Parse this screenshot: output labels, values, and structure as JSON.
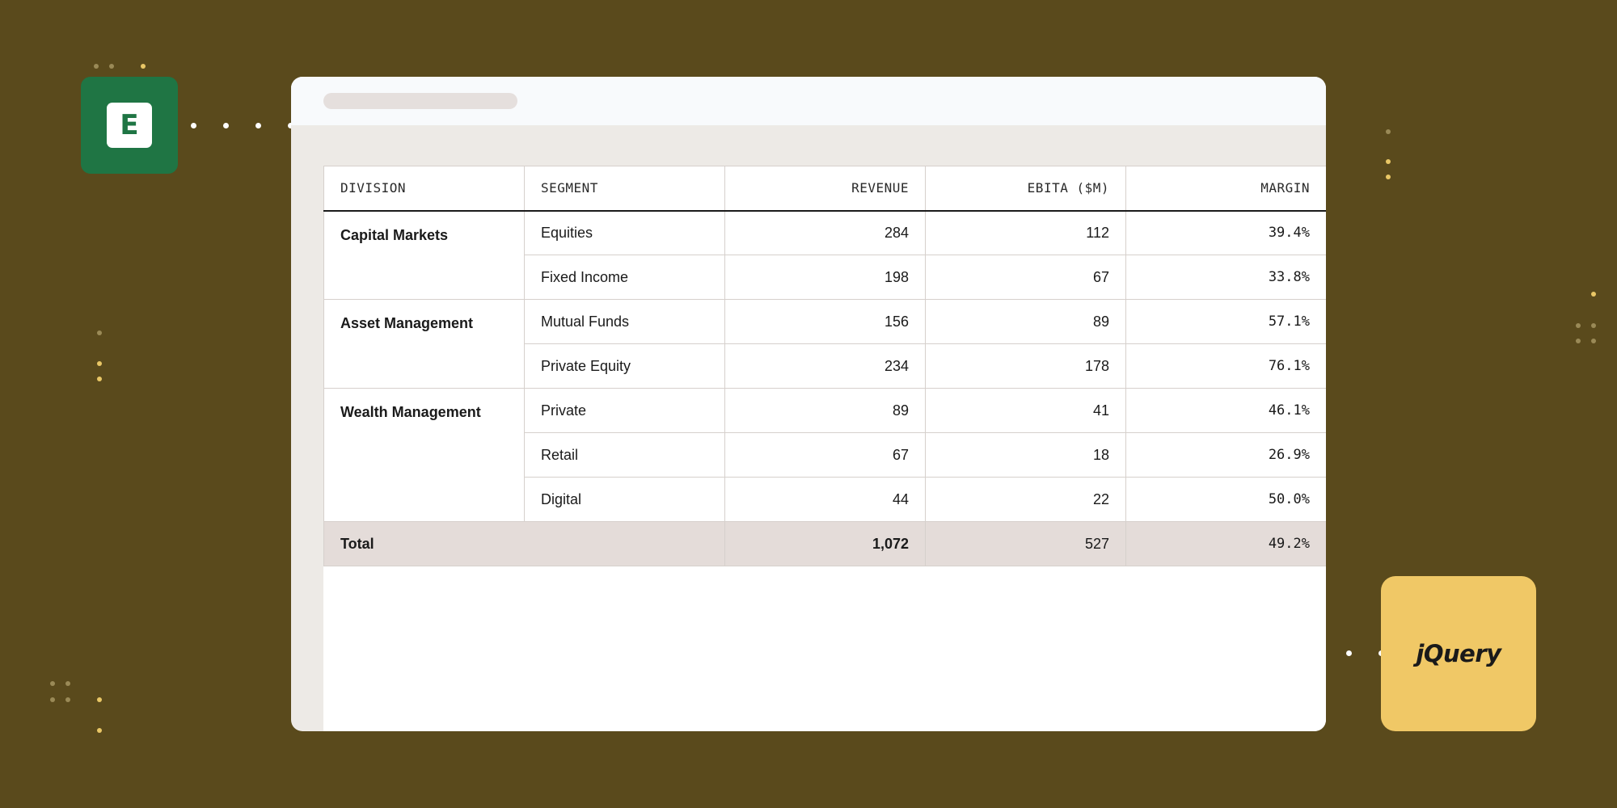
{
  "decor": {
    "excel_letter": "E",
    "jquery_text": "jQuery"
  },
  "table": {
    "headers": [
      "DIVISION",
      "SEGMENT",
      "REVENUE",
      "EBITA ($M)",
      "MARGIN"
    ],
    "groups": [
      {
        "division": "Capital Markets",
        "rows": [
          {
            "segment": "Equities",
            "revenue": "284",
            "ebita": "112",
            "margin": "39.4%"
          },
          {
            "segment": "Fixed Income",
            "revenue": "198",
            "ebita": "67",
            "margin": "33.8%"
          }
        ]
      },
      {
        "division": "Asset Management",
        "rows": [
          {
            "segment": "Mutual Funds",
            "revenue": "156",
            "ebita": "89",
            "margin": "57.1%"
          },
          {
            "segment": "Private Equity",
            "revenue": "234",
            "ebita": "178",
            "margin": "76.1%"
          }
        ]
      },
      {
        "division": "Wealth Management",
        "rows": [
          {
            "segment": "Private",
            "revenue": "89",
            "ebita": "41",
            "margin": "46.1%"
          },
          {
            "segment": "Retail",
            "revenue": "67",
            "ebita": "18",
            "margin": "26.9%"
          },
          {
            "segment": "Digital",
            "revenue": "44",
            "ebita": "22",
            "margin": "50.0%"
          }
        ]
      }
    ],
    "total": {
      "label": "Total",
      "revenue": "1,072",
      "ebita": "527",
      "margin": "49.2%"
    }
  },
  "colors": {
    "background": "#5a4a1c",
    "excel_green": "#1f7544",
    "jquery_yellow": "#f0c866",
    "total_row": "#e4dcd9"
  }
}
